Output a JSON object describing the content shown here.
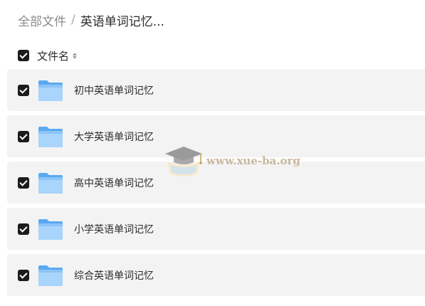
{
  "breadcrumb": {
    "root": "全部文件",
    "separator": "/",
    "current": "英语单词记忆..."
  },
  "header": {
    "column_label": "文件名"
  },
  "files": [
    {
      "name": "初中英语单词记忆"
    },
    {
      "name": "大学英语单词记忆"
    },
    {
      "name": "高中英语单词记忆"
    },
    {
      "name": "小学英语单词记忆"
    },
    {
      "name": "综合英语单词记忆"
    }
  ],
  "watermark": {
    "text": "www.xue-ba.org"
  },
  "icons": {
    "row_icon": "folder-icon",
    "sort": "sort-icon",
    "checkbox": "checked-checkbox"
  },
  "colors": {
    "row_background": "#f3f3f4",
    "checkbox": "#1b1b1d",
    "folder_light": "#a9d4fb",
    "folder_dark": "#5aa9f0"
  }
}
